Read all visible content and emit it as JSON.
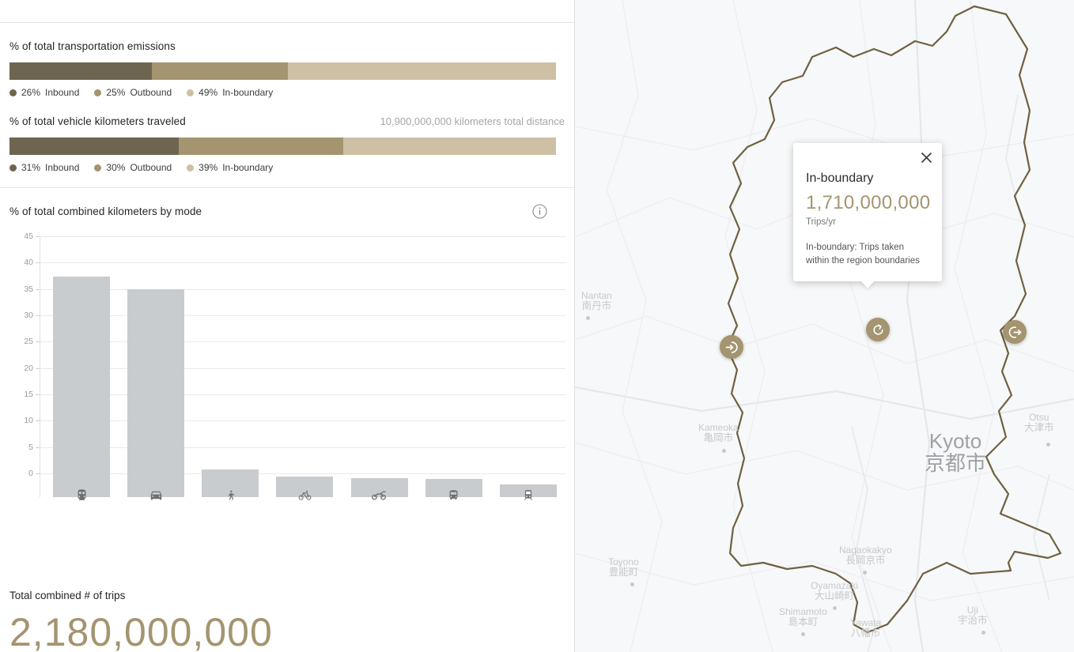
{
  "emissions": {
    "title": "% of total transportation emissions",
    "segments": [
      {
        "label": "Inbound",
        "pct": "26%",
        "value": 26,
        "color": "#6e6550"
      },
      {
        "label": "Outbound",
        "pct": "25%",
        "value": 25,
        "color": "#a4946f"
      },
      {
        "label": "In-boundary",
        "pct": "49%",
        "value": 49,
        "color": "#cec0a4"
      }
    ]
  },
  "vkt": {
    "title": "% of total vehicle kilometers traveled",
    "note": "10,900,000,000 kilometers total distance",
    "segments": [
      {
        "label": "Inbound",
        "pct": "31%",
        "value": 31,
        "color": "#6e6550"
      },
      {
        "label": "Outbound",
        "pct": "30%",
        "value": 30,
        "color": "#a4946f"
      },
      {
        "label": "In-boundary",
        "pct": "39%",
        "value": 39,
        "color": "#cec0a4"
      }
    ]
  },
  "mode_chart": {
    "title": "% of total combined kilometers by mode",
    "info_icon": "info-icon"
  },
  "chart_data": {
    "type": "bar",
    "title": "% of total combined kilometers by mode",
    "xlabel": "",
    "ylabel": "",
    "ylim": [
      0,
      45
    ],
    "yticks": [
      0,
      5,
      10,
      15,
      20,
      25,
      30,
      35,
      40,
      45
    ],
    "ytick_labels": [
      "0",
      "5",
      "10",
      "15",
      "20",
      "25",
      "30",
      "35",
      "40",
      "45"
    ],
    "grid": true,
    "legend": "none",
    "bar_color": "#c9cccf",
    "categories": [
      "train",
      "car",
      "walk",
      "bicycle",
      "motorcycle",
      "bus",
      "tram"
    ],
    "values": [
      41.9,
      39.5,
      5.2,
      3.9,
      3.6,
      3.4,
      2.4
    ]
  },
  "total": {
    "label": "Total combined # of trips",
    "value": "2,180,000,000",
    "color": "#a4946f"
  },
  "map": {
    "markers": [
      {
        "name": "inbound",
        "icon": "arrow-into-circle-icon"
      },
      {
        "name": "in-boundary",
        "icon": "circular-arrow-icon"
      },
      {
        "name": "outbound",
        "icon": "arrow-out-of-circle-icon"
      }
    ],
    "labels": [
      {
        "en": "Kyoto",
        "ja": "京都市",
        "big": true
      },
      {
        "en": "Otsu",
        "ja": "大津市",
        "big": false
      },
      {
        "en": "Kameoka",
        "ja": "亀岡市",
        "big": false
      },
      {
        "en": "Nantan",
        "ja": "南丹市",
        "big": false
      },
      {
        "en": "Toyono",
        "ja": "豊能町",
        "big": false
      },
      {
        "en": "Nagaokakyo",
        "ja": "長岡京市",
        "big": false
      },
      {
        "en": "Oyamazaki",
        "ja": "大山崎町",
        "big": false
      },
      {
        "en": "Shimamoto",
        "ja": "島本町",
        "big": false
      },
      {
        "en": "Yawata",
        "ja": "八幡市",
        "big": false
      },
      {
        "en": "Uji",
        "ja": "宇治市",
        "big": false
      }
    ]
  },
  "popup": {
    "title": "In-boundary",
    "value": "1,710,000,000",
    "unit": "Trips/yr",
    "description": "In-boundary: Trips taken within the region boundaries",
    "close_icon": "close-icon"
  }
}
